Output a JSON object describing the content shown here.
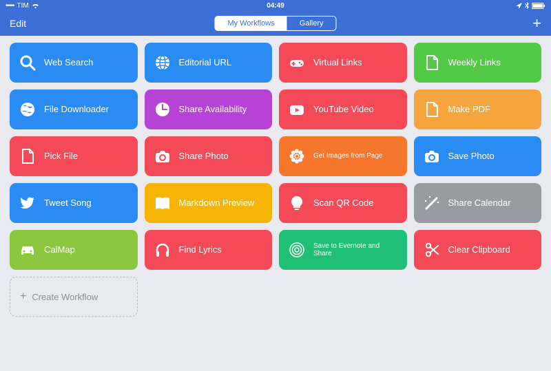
{
  "status": {
    "carrier": "TIM",
    "time": "04:49"
  },
  "header": {
    "edit_label": "Edit",
    "tabs": {
      "my_workflows": "My Workflows",
      "gallery": "Gallery"
    }
  },
  "tiles": [
    {
      "label": "Web Search",
      "icon": "search-icon",
      "color": "#2a8bf2"
    },
    {
      "label": "Editorial URL",
      "icon": "globe-icon",
      "color": "#2a8bf2"
    },
    {
      "label": "Virtual Links",
      "icon": "gamepad-icon",
      "color": "#f44956"
    },
    {
      "label": "Weekly Links",
      "icon": "document-icon",
      "color": "#54c947"
    },
    {
      "label": "File Downloader",
      "icon": "globe-alt-icon",
      "color": "#2a8bf2"
    },
    {
      "label": "Share Availability",
      "icon": "clock-icon",
      "color": "#b742d6"
    },
    {
      "label": "YouTube Video",
      "icon": "play-icon",
      "color": "#f44956"
    },
    {
      "label": "Make PDF",
      "icon": "document-icon",
      "color": "#f6a43e"
    },
    {
      "label": "Pick File",
      "icon": "document-icon",
      "color": "#f44956"
    },
    {
      "label": "Share Photo",
      "icon": "camera-icon",
      "color": "#f44956"
    },
    {
      "label": "Get Images from Page",
      "icon": "flower-icon",
      "color": "#f6772c",
      "small": true
    },
    {
      "label": "Save Photo",
      "icon": "camera-icon",
      "color": "#2a8bf2"
    },
    {
      "label": "Tweet Song",
      "icon": "twitter-icon",
      "color": "#2a8bf2"
    },
    {
      "label": "Markdown Preview",
      "icon": "book-icon",
      "color": "#f6b506"
    },
    {
      "label": "Scan QR Code",
      "icon": "bulb-icon",
      "color": "#f44956"
    },
    {
      "label": "Share Calendar",
      "icon": "wand-icon",
      "color": "#989ba2"
    },
    {
      "label": "CalMap",
      "icon": "car-icon",
      "color": "#8cc63e"
    },
    {
      "label": "Find Lyrics",
      "icon": "headphones-icon",
      "color": "#f44956"
    },
    {
      "label": "Save to Evernote and Share",
      "icon": "target-icon",
      "color": "#1fbf76",
      "small": true
    },
    {
      "label": "Clear Clipboard",
      "icon": "scissors-icon",
      "color": "#f44956"
    }
  ],
  "create_label": "Create Workflow"
}
